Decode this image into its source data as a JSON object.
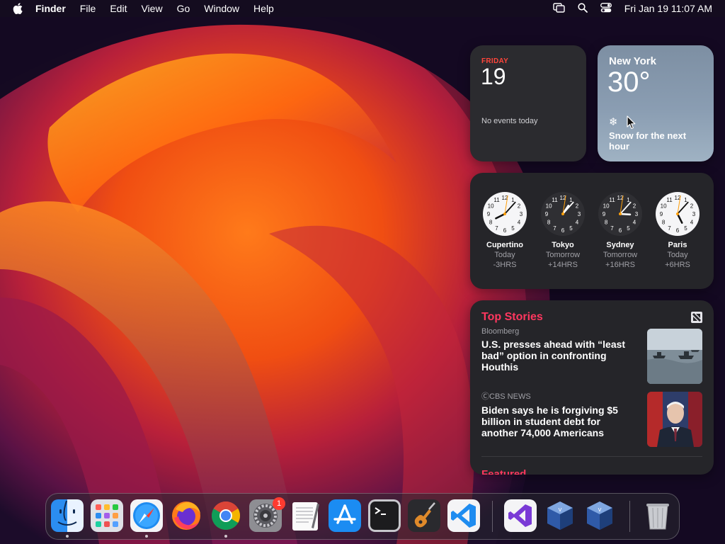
{
  "menubar": {
    "app_name": "Finder",
    "menus": [
      "File",
      "Edit",
      "View",
      "Go",
      "Window",
      "Help"
    ],
    "datetime": "Fri Jan 19  11:07 AM",
    "status_icons": [
      "screen-mirroring-icon",
      "spotlight-search-icon",
      "control-center-icon"
    ]
  },
  "calendar_widget": {
    "weekday": "FRIDAY",
    "date": "19",
    "events": "No events today",
    "accent_color": "#ff453a"
  },
  "weather_widget": {
    "city": "New York",
    "temperature": "30°",
    "condition_icon": "snowflake-icon",
    "description": "Snow for the next hour"
  },
  "world_clock_widget": {
    "clocks": [
      {
        "city": "Cupertino",
        "relative_day": "Today",
        "offset": "-3HRS",
        "face": "light",
        "hour": 8,
        "minute": 7
      },
      {
        "city": "Tokyo",
        "relative_day": "Tomorrow",
        "offset": "+14HRS",
        "face": "dark",
        "hour": 1,
        "minute": 7
      },
      {
        "city": "Sydney",
        "relative_day": "Tomorrow",
        "offset": "+16HRS",
        "face": "dark",
        "hour": 3,
        "minute": 7
      },
      {
        "city": "Paris",
        "relative_day": "Today",
        "offset": "+6HRS",
        "face": "light",
        "hour": 5,
        "minute": 7
      }
    ]
  },
  "news_widget": {
    "title": "Top Stories",
    "stories": [
      {
        "source": "Bloomberg",
        "headline": "U.S. presses ahead with “least bad” option in confronting Houthis"
      },
      {
        "source": "ⒸCBS NEWS",
        "headline": "Biden says he is forgiving $5 billion in student debt for another 74,000 Americans"
      }
    ],
    "next_section": "Featured",
    "accent_color": "#ff375f"
  },
  "dock": {
    "apps": [
      "Finder",
      "Launchpad",
      "Safari",
      "Firefox",
      "Google Chrome",
      "System Settings",
      "TextEdit",
      "App Store",
      "Terminal",
      "GarageBand",
      "Visual Studio Code",
      "Visual Studio",
      "VirtualBox",
      "VirtualBox",
      "Trash"
    ],
    "settings_badge": "1"
  }
}
